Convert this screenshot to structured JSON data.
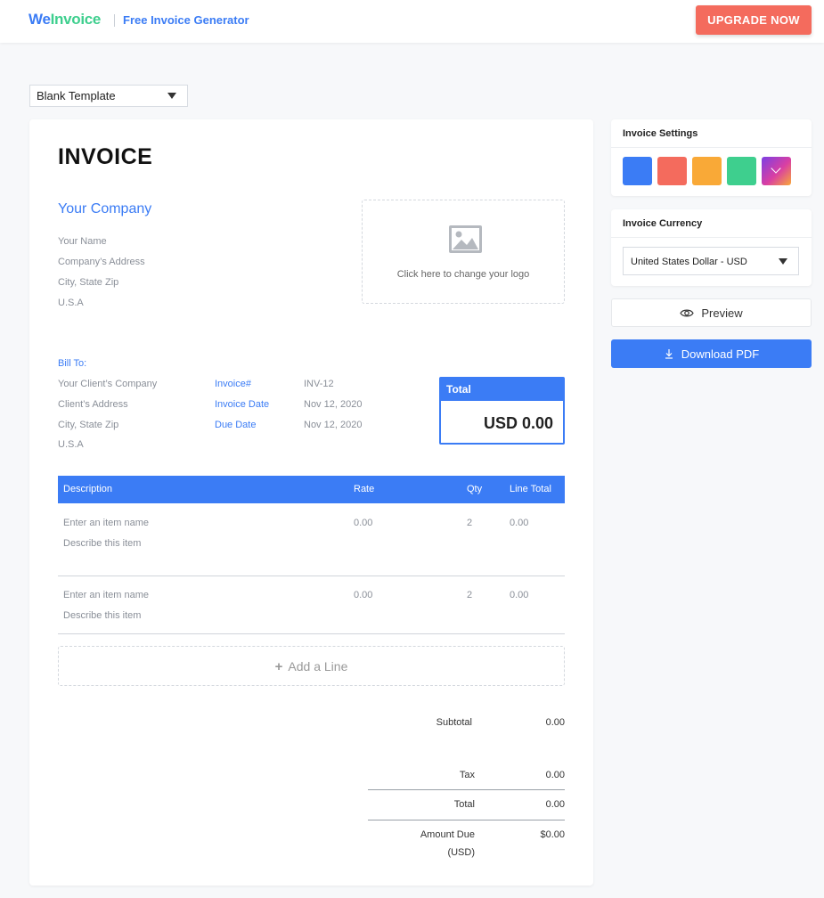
{
  "header": {
    "logo_we": "We",
    "logo_invoice": "Invoice",
    "title": "Free Invoice Generator",
    "upgrade_label": "UPGRADE NOW"
  },
  "template": {
    "selected": "Blank Template"
  },
  "invoice": {
    "heading": "INVOICE",
    "company_name": "Your Company",
    "sender": {
      "name": "Your Name",
      "address": "Company’s Address",
      "city": "City, State Zip",
      "country": "U.S.A"
    },
    "logo_text": "Click here to change your logo",
    "bill_to_label": "Bill To:",
    "client": {
      "company": "Your Client’s Company",
      "address": "Client’s Address",
      "city": "City, State Zip",
      "country": "U.S.A"
    },
    "meta": {
      "invoice_no_label": "Invoice#",
      "invoice_no": "INV-12",
      "invoice_date_label": "Invoice Date",
      "invoice_date": "Nov 12, 2020",
      "due_date_label": "Due Date",
      "due_date": "Nov 12, 2020"
    },
    "total_box": {
      "label": "Total",
      "value": "USD 0.00"
    },
    "table": {
      "headers": {
        "description": "Description",
        "rate": "Rate",
        "qty": "Qty",
        "line_total": "Line Total"
      },
      "rows": [
        {
          "name": "Enter an item name",
          "desc": "Describe this item",
          "rate": "0.00",
          "qty": "2",
          "total": "0.00"
        },
        {
          "name": "Enter an item name",
          "desc": "Describe this item",
          "rate": "0.00",
          "qty": "2",
          "total": "0.00"
        }
      ]
    },
    "add_line_label": "Add a Line",
    "summary": {
      "subtotal_label": "Subtotal",
      "subtotal": "0.00",
      "tax_label": "Tax",
      "tax": "0.00",
      "total_label": "Total",
      "total": "0.00",
      "amount_due_label": "Amount Due",
      "amount_due_unit": "(USD)",
      "amount_due": "$0.00"
    }
  },
  "settings": {
    "title": "Invoice Settings",
    "colors": [
      "#3b7cf5",
      "#f46b5d",
      "#f9a937",
      "#3ecf8e"
    ],
    "more_colors_icon": "chevron-down-icon"
  },
  "currency": {
    "title": "Invoice Currency",
    "selected": "United States Dollar - USD"
  },
  "actions": {
    "preview_label": "Preview",
    "download_label": "Download PDF"
  }
}
